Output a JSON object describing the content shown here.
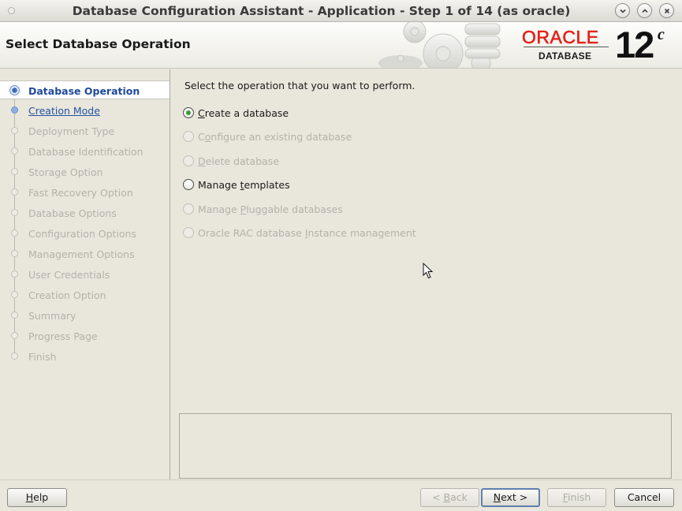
{
  "window": {
    "title": "Database Configuration Assistant - Application - Step 1 of 14 (as oracle)",
    "controls": [
      "minimize-icon",
      "maximize-icon",
      "close-icon"
    ]
  },
  "header": {
    "page_title": "Select Database Operation",
    "logo_wordmark": "ORACLE",
    "logo_product": "DATABASE",
    "logo_version": "12",
    "logo_version_suffix": "c",
    "brand_color": "#e2231a"
  },
  "sidebar": {
    "steps": [
      {
        "label": "Database Operation",
        "state": "current"
      },
      {
        "label": "Creation Mode",
        "state": "link"
      },
      {
        "label": "Deployment Type",
        "state": "disabled"
      },
      {
        "label": "Database Identification",
        "state": "disabled"
      },
      {
        "label": "Storage Option",
        "state": "disabled"
      },
      {
        "label": "Fast Recovery Option",
        "state": "disabled"
      },
      {
        "label": "Database Options",
        "state": "disabled"
      },
      {
        "label": "Configuration Options",
        "state": "disabled"
      },
      {
        "label": "Management Options",
        "state": "disabled"
      },
      {
        "label": "User Credentials",
        "state": "disabled"
      },
      {
        "label": "Creation Option",
        "state": "disabled"
      },
      {
        "label": "Summary",
        "state": "disabled"
      },
      {
        "label": "Progress Page",
        "state": "disabled"
      },
      {
        "label": "Finish",
        "state": "disabled"
      }
    ]
  },
  "main": {
    "prompt": "Select the operation that you want to perform.",
    "options": [
      {
        "label": "Create a database",
        "mnemonic_prefix": "",
        "mnemonic": "C",
        "rest": "reate a database",
        "checked": true,
        "enabled": true
      },
      {
        "label": "Configure an existing database",
        "mnemonic_prefix": "C",
        "mnemonic": "o",
        "rest": "nfigure an existing database",
        "checked": false,
        "enabled": false
      },
      {
        "label": "Delete database",
        "mnemonic_prefix": "",
        "mnemonic": "D",
        "rest": "elete database",
        "checked": false,
        "enabled": false
      },
      {
        "label": "Manage templates",
        "mnemonic_prefix": "Manage ",
        "mnemonic": "t",
        "rest": "emplates",
        "checked": false,
        "enabled": true
      },
      {
        "label": "Manage Pluggable databases",
        "mnemonic_prefix": "Manage ",
        "mnemonic": "P",
        "rest": "luggable databases",
        "checked": false,
        "enabled": false
      },
      {
        "label": "Oracle RAC database Instance management",
        "mnemonic_prefix": "Oracle RAC database ",
        "mnemonic": "I",
        "rest": "nstance management",
        "checked": false,
        "enabled": false
      }
    ],
    "messages": ""
  },
  "footer": {
    "help": {
      "mnemonic": "H",
      "rest": "elp",
      "label": "Help"
    },
    "back": {
      "label": "< Back",
      "prefix": "< ",
      "mnemonic": "B",
      "rest": "ack",
      "enabled": false
    },
    "next": {
      "label": "Next >",
      "prefix": "",
      "mnemonic": "N",
      "rest": "ext >",
      "enabled": true
    },
    "finish": {
      "label": "Finish",
      "prefix": "",
      "mnemonic": "F",
      "rest": "inish",
      "enabled": false
    },
    "cancel": {
      "label": "Cancel"
    }
  }
}
